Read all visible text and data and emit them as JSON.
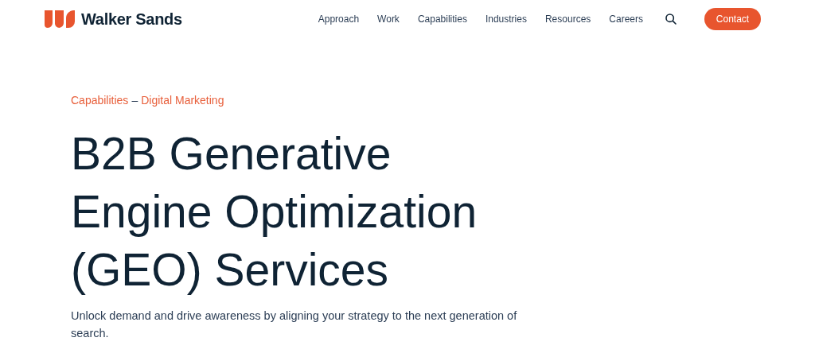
{
  "header": {
    "logo_text": "Walker Sands",
    "nav": [
      {
        "label": "Approach"
      },
      {
        "label": "Work"
      },
      {
        "label": "Capabilities"
      },
      {
        "label": "Industries"
      },
      {
        "label": "Resources"
      },
      {
        "label": "Careers"
      }
    ],
    "cta": "Contact"
  },
  "breadcrumb": {
    "items": [
      "Capabilities",
      "Digital Marketing"
    ],
    "separator": "–"
  },
  "hero": {
    "title_lines": [
      "B2B Generative",
      "Engine Optimization",
      "(GEO) Services"
    ],
    "subtitle": "Unlock demand and drive awareness by aligning your strategy to the next generation of search."
  }
}
